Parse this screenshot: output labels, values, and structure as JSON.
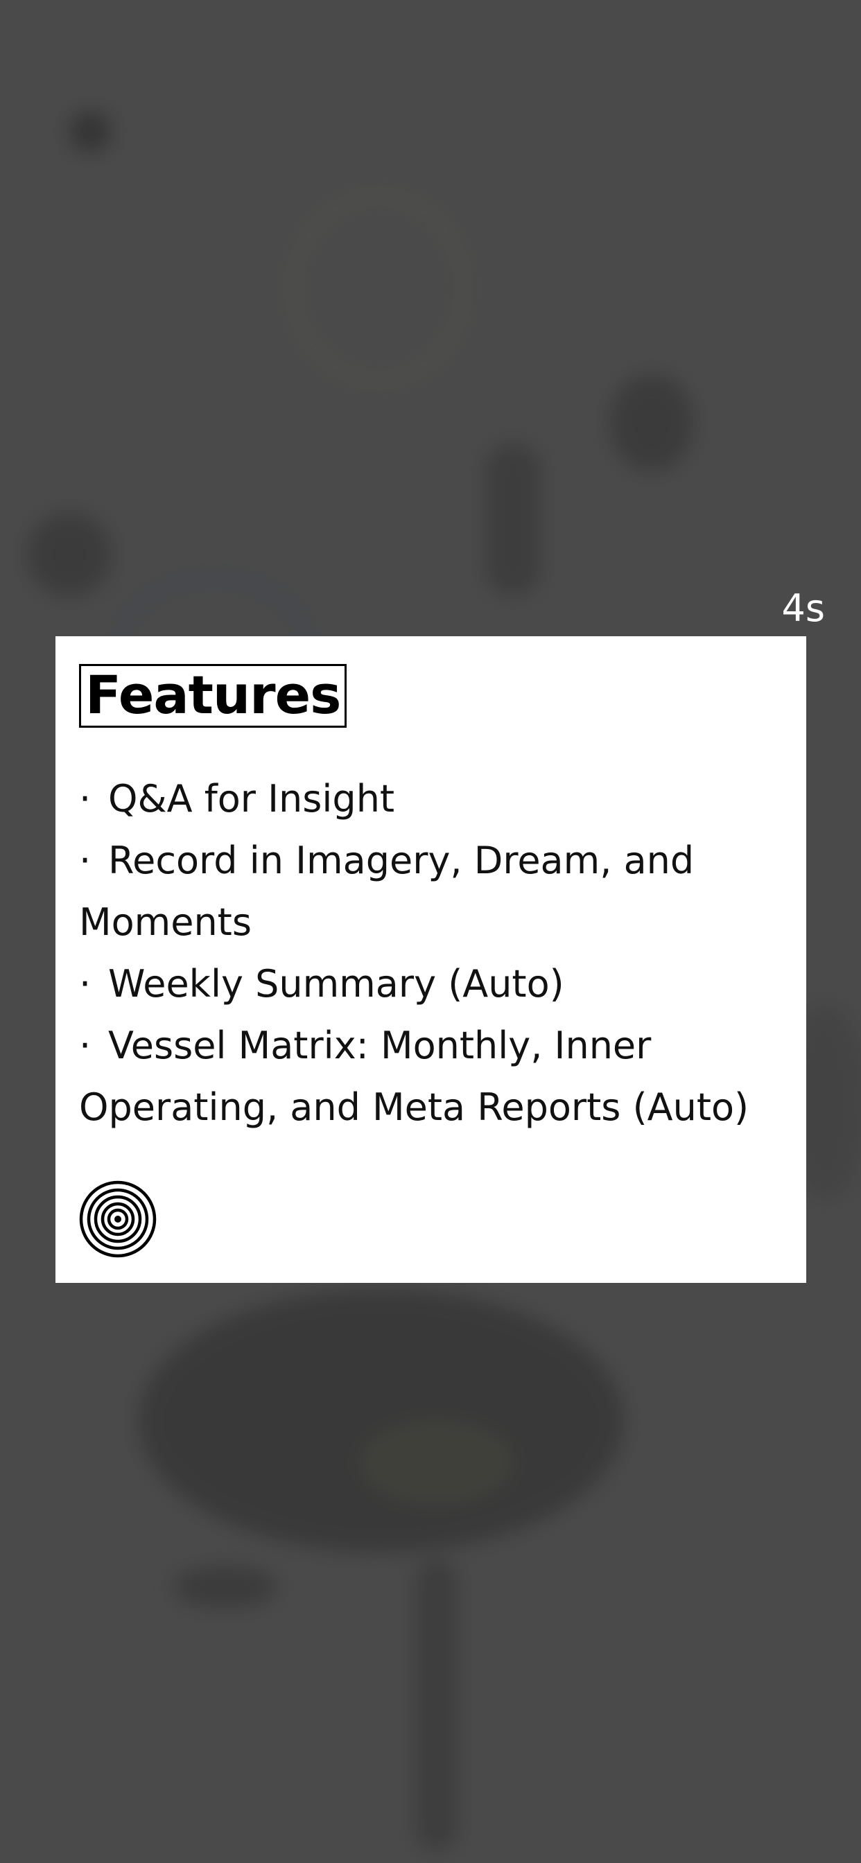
{
  "countdown": "4s",
  "modal": {
    "title": "Features",
    "items": [
      "Q&A for Insight",
      "Record in Imagery, Dream, and Moments",
      "Weekly Summary (Auto)",
      "Vessel Matrix: Monthly, Inner Operating, and Meta Reports (Auto)"
    ],
    "bullet": "·",
    "logo_icon": "concentric-circles-icon"
  },
  "colors": {
    "overlay": "#4a4a4a",
    "card": "#ffffff",
    "text": "#000000"
  }
}
